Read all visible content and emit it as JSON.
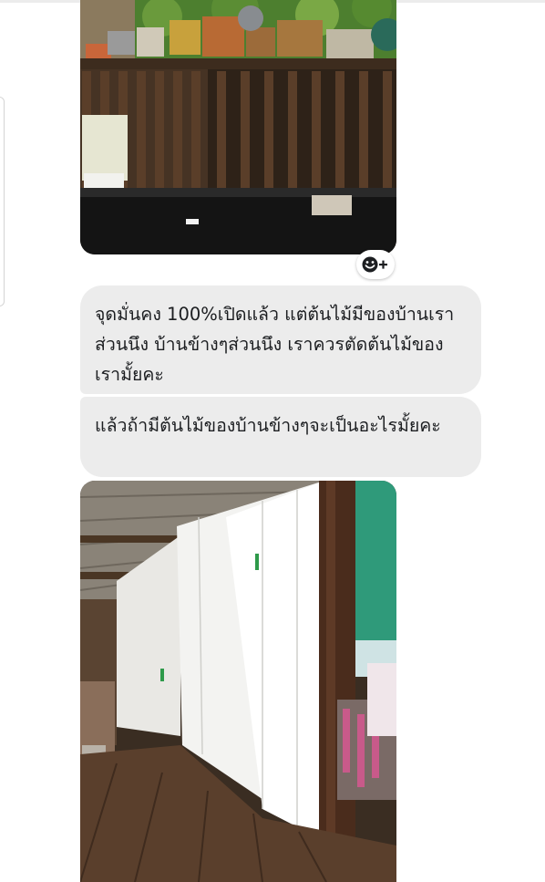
{
  "conversation": {
    "messages": [
      {
        "type": "image",
        "alt": ""
      },
      {
        "type": "text",
        "text": "จุดมั่นคง 100%เปิดแล้ว แต่ต้นไม้มีของบ้านเราส่วนนึง บ้านข้างๆส่วนนึง เราควรตัดต้นไม้ของเรามั้ยคะ"
      },
      {
        "type": "text",
        "text": "แล้วถ้ามีต้นไม้ของบ้านข้างๆจะเป็นอะไรมั้ยคะ"
      },
      {
        "type": "image",
        "alt": ""
      }
    ],
    "reaction_button": {
      "icon": "smiley-plus-icon",
      "symbol": "+"
    }
  }
}
